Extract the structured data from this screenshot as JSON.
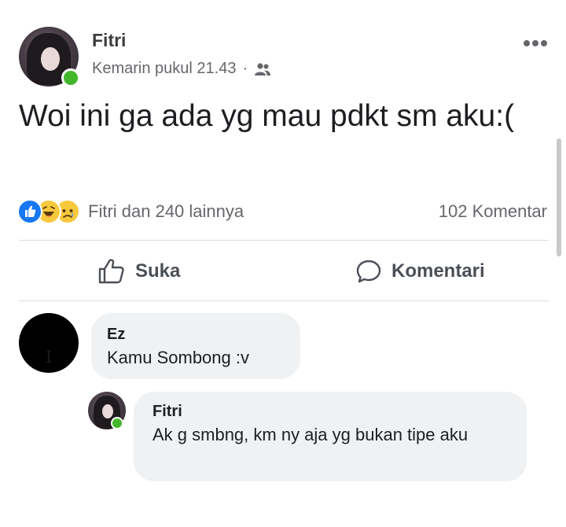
{
  "post": {
    "author": "Fitri",
    "timestamp": "Kemarin pukul 21.43",
    "separator": "·",
    "audience_icon": "people-icon",
    "text": "Woi ini ga ada yg mau pdkt sm aku:(",
    "reactions": {
      "icons": [
        "like",
        "haha",
        "sad"
      ],
      "summary": "Fitri dan 240 lainnya"
    },
    "comment_count": "102 Komentar",
    "actions": {
      "like_label": "Suka",
      "comment_label": "Komentari"
    }
  },
  "comments": [
    {
      "author": "Ez",
      "text": "Kamu Sombong :v",
      "replies": [
        {
          "author": "Fitri",
          "text": "Ak g smbng, km ny aja yg bukan tipe aku"
        }
      ]
    }
  ],
  "colors": {
    "online": "#42b72a",
    "like_blue": "#1877f2",
    "bubble_bg": "#eff1f3",
    "secondary_text": "#65676b"
  }
}
